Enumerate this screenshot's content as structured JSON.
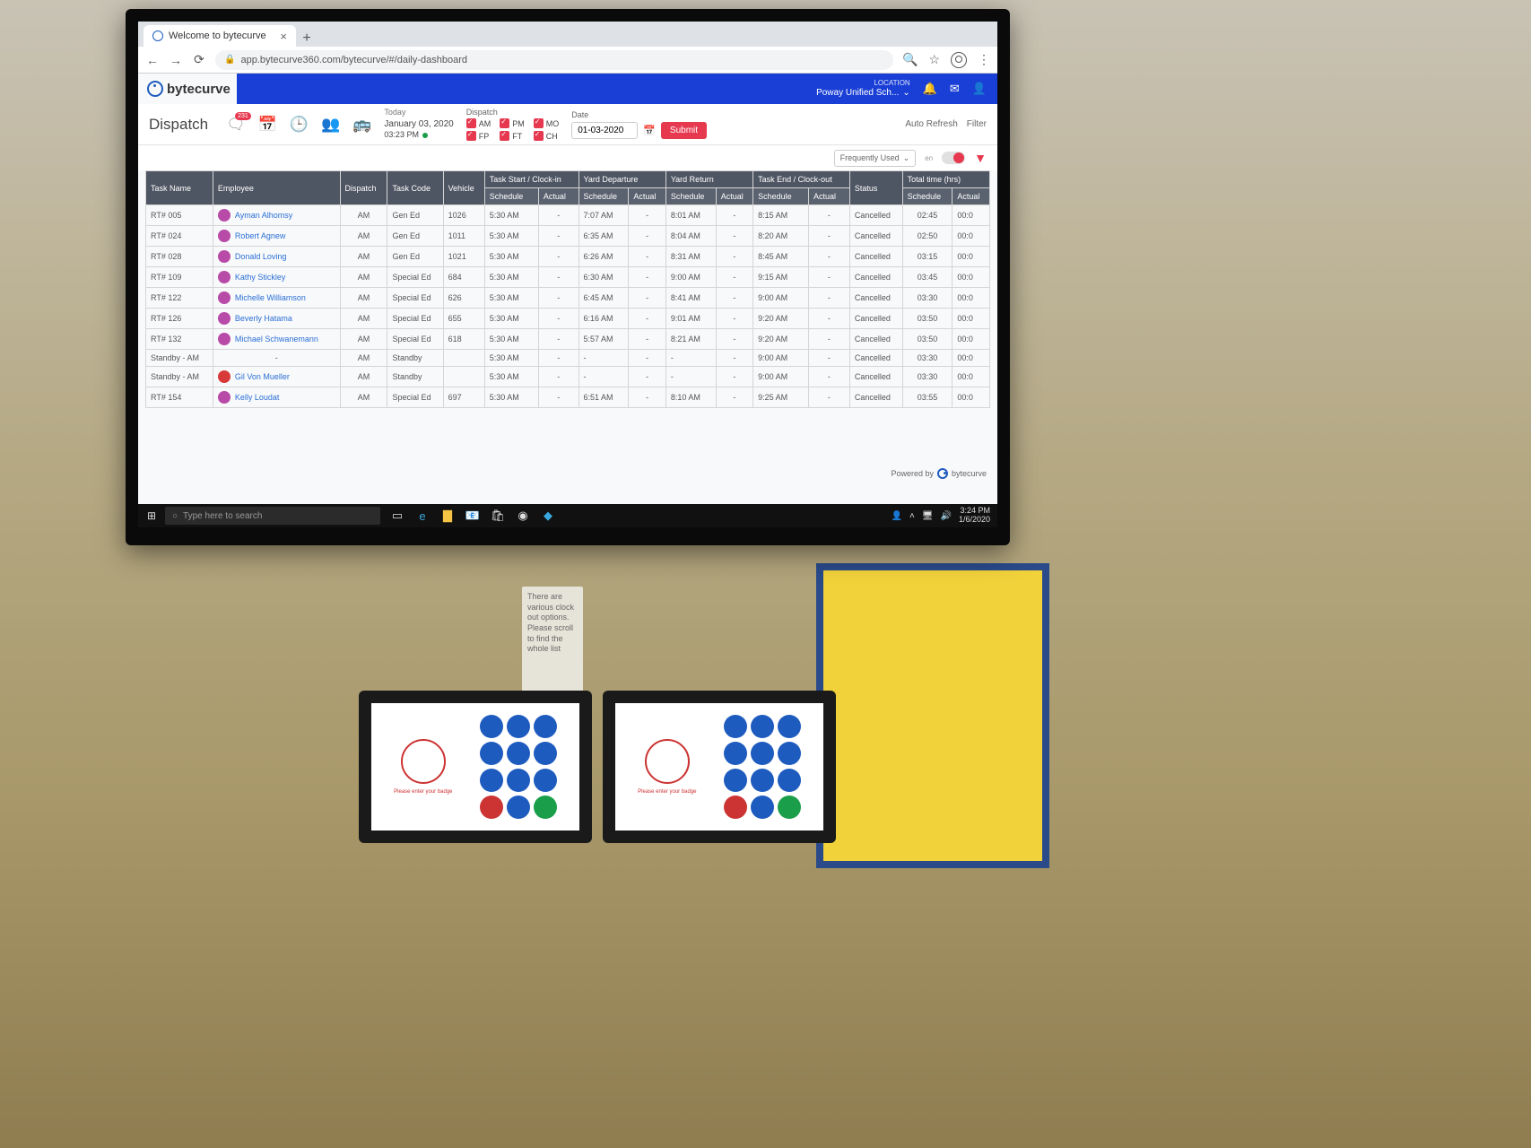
{
  "browser": {
    "tab_title": "Welcome to bytecurve",
    "url": "app.bytecurve360.com/bytecurve/#/daily-dashboard"
  },
  "brand": "bytecurve",
  "header": {
    "location_label": "LOCATION",
    "location_value": "Poway Unified Sch..."
  },
  "page": {
    "title": "Dispatch",
    "badge_count": "231",
    "today_label": "Today",
    "today_date": "January 03, 2020",
    "today_time": "03:23 PM",
    "dispatch_label": "Dispatch",
    "checks": {
      "am": "AM",
      "pm": "PM",
      "mo": "MO",
      "fp": "FP",
      "ft": "FT",
      "ch": "CH"
    },
    "date_label": "Date",
    "date_value": "01-03-2020",
    "submit": "Submit",
    "auto_refresh": "Auto Refresh",
    "filter": "Filter",
    "freq_used": "Frequently Used",
    "toggle_en": "en"
  },
  "table": {
    "headers": {
      "task_name": "Task Name",
      "employee": "Employee",
      "dispatch": "Dispatch",
      "task_code": "Task Code",
      "vehicle": "Vehicle",
      "task_start": "Task Start / Clock-in",
      "yard_dep": "Yard Departure",
      "yard_ret": "Yard Return",
      "task_end": "Task End / Clock-out",
      "status": "Status",
      "total_time": "Total time (hrs)",
      "schedule": "Schedule",
      "actual": "Actual"
    },
    "rows": [
      {
        "task": "RT# 005",
        "emp": "Ayman Alhomsy",
        "disp": "AM",
        "code": "Gen Ed",
        "veh": "1026",
        "ts_s": "5:30 AM",
        "ts_a": "-",
        "yd_s": "7:07 AM",
        "yd_a": "",
        "yr_s": "8:01 AM",
        "yr_a": "-",
        "te_s": "8:15 AM",
        "te_a": "-",
        "status": "Cancelled",
        "tt_s": "02:45",
        "tt_a": "00:0"
      },
      {
        "task": "RT# 024",
        "emp": "Robert Agnew",
        "disp": "AM",
        "code": "Gen Ed",
        "veh": "1011",
        "ts_s": "5:30 AM",
        "ts_a": "-",
        "yd_s": "6:35 AM",
        "yd_a": "",
        "yr_s": "8:04 AM",
        "yr_a": "-",
        "te_s": "8:20 AM",
        "te_a": "-",
        "status": "Cancelled",
        "tt_s": "02:50",
        "tt_a": "00:0"
      },
      {
        "task": "RT# 028",
        "emp": "Donald Loving",
        "disp": "AM",
        "code": "Gen Ed",
        "veh": "1021",
        "ts_s": "5:30 AM",
        "ts_a": "-",
        "yd_s": "6:26 AM",
        "yd_a": "",
        "yr_s": "8:31 AM",
        "yr_a": "-",
        "te_s": "8:45 AM",
        "te_a": "-",
        "status": "Cancelled",
        "tt_s": "03:15",
        "tt_a": "00:0"
      },
      {
        "task": "RT# 109",
        "emp": "Kathy Stickley",
        "disp": "AM",
        "code": "Special Ed",
        "veh": "684",
        "ts_s": "5:30 AM",
        "ts_a": "-",
        "yd_s": "6:30 AM",
        "yd_a": "",
        "yr_s": "9:00 AM",
        "yr_a": "-",
        "te_s": "9:15 AM",
        "te_a": "-",
        "status": "Cancelled",
        "tt_s": "03:45",
        "tt_a": "00:0"
      },
      {
        "task": "RT# 122",
        "emp": "Michelle Williamson",
        "disp": "AM",
        "code": "Special Ed",
        "veh": "626",
        "ts_s": "5:30 AM",
        "ts_a": "-",
        "yd_s": "6:45 AM",
        "yd_a": "",
        "yr_s": "8:41 AM",
        "yr_a": "-",
        "te_s": "9:00 AM",
        "te_a": "-",
        "status": "Cancelled",
        "tt_s": "03:30",
        "tt_a": "00:0"
      },
      {
        "task": "RT# 126",
        "emp": "Beverly Hatama",
        "disp": "AM",
        "code": "Special Ed",
        "veh": "655",
        "ts_s": "5:30 AM",
        "ts_a": "-",
        "yd_s": "6:16 AM",
        "yd_a": "",
        "yr_s": "9:01 AM",
        "yr_a": "-",
        "te_s": "9:20 AM",
        "te_a": "-",
        "status": "Cancelled",
        "tt_s": "03:50",
        "tt_a": "00:0"
      },
      {
        "task": "RT# 132",
        "emp": "Michael Schwanemann",
        "disp": "AM",
        "code": "Special Ed",
        "veh": "618",
        "ts_s": "5:30 AM",
        "ts_a": "-",
        "yd_s": "5:57 AM",
        "yd_a": "",
        "yr_s": "8:21 AM",
        "yr_a": "-",
        "te_s": "9:20 AM",
        "te_a": "-",
        "status": "Cancelled",
        "tt_s": "03:50",
        "tt_a": "00:0"
      },
      {
        "task": "Standby - AM",
        "emp": "-",
        "disp": "AM",
        "code": "Standby",
        "veh": "",
        "ts_s": "5:30 AM",
        "ts_a": "-",
        "yd_s": "-",
        "yd_a": "-",
        "yr_s": "-",
        "yr_a": "-",
        "te_s": "9:00 AM",
        "te_a": "-",
        "status": "Cancelled",
        "tt_s": "03:30",
        "tt_a": "00:0"
      },
      {
        "task": "Standby - AM",
        "emp": "Gil Von Mueller",
        "ava": "red",
        "disp": "AM",
        "code": "Standby",
        "veh": "",
        "ts_s": "5:30 AM",
        "ts_a": "-",
        "yd_s": "-",
        "yd_a": "-",
        "yr_s": "-",
        "yr_a": "-",
        "te_s": "9:00 AM",
        "te_a": "-",
        "status": "Cancelled",
        "tt_s": "03:30",
        "tt_a": "00:0"
      },
      {
        "task": "RT# 154",
        "emp": "Kelly Loudat",
        "disp": "AM",
        "code": "Special Ed",
        "veh": "697",
        "ts_s": "5:30 AM",
        "ts_a": "-",
        "yd_s": "6:51 AM",
        "yd_a": "",
        "yr_s": "8:10 AM",
        "yr_a": "-",
        "te_s": "9:25 AM",
        "te_a": "-",
        "status": "Cancelled",
        "tt_s": "03:55",
        "tt_a": "00:0"
      }
    ]
  },
  "powered_by": "Powered by",
  "taskbar": {
    "search_placeholder": "Type here to search",
    "time": "3:24 PM",
    "date": "1/6/2020"
  },
  "wall_note": "There are various clock out options. Please scroll to find the whole list"
}
